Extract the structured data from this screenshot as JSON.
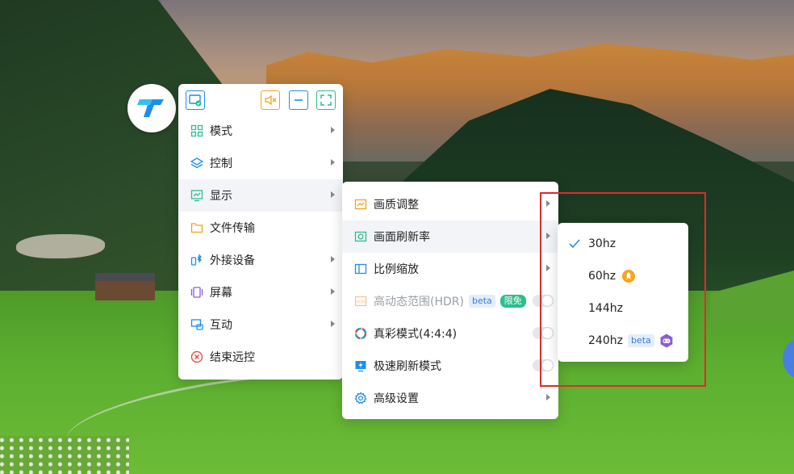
{
  "main_menu": {
    "items": [
      {
        "label": "模式"
      },
      {
        "label": "控制"
      },
      {
        "label": "显示"
      },
      {
        "label": "文件传输"
      },
      {
        "label": "外接设备"
      },
      {
        "label": "屏幕"
      },
      {
        "label": "互动"
      },
      {
        "label": "结束远控"
      }
    ]
  },
  "display_menu": {
    "items": [
      {
        "label": "画质调整"
      },
      {
        "label": "画面刷新率"
      },
      {
        "label": "比例缩放"
      },
      {
        "label": "高动态范围(HDR)",
        "badge_beta": "beta",
        "badge_free": "限免"
      },
      {
        "label": "真彩模式(4:4:4)"
      },
      {
        "label": "极速刷新模式"
      },
      {
        "label": "高级设置"
      }
    ]
  },
  "refresh_rate_menu": {
    "items": [
      {
        "label": "30hz",
        "selected": true
      },
      {
        "label": "60hz"
      },
      {
        "label": "144hz"
      },
      {
        "label": "240hz",
        "badge": "beta"
      }
    ]
  },
  "colors": {
    "accent_blue": "#1e8ee8",
    "orange": "#f0a21a",
    "green": "#2bbf8a",
    "highlight_box": "#e02b2b"
  }
}
